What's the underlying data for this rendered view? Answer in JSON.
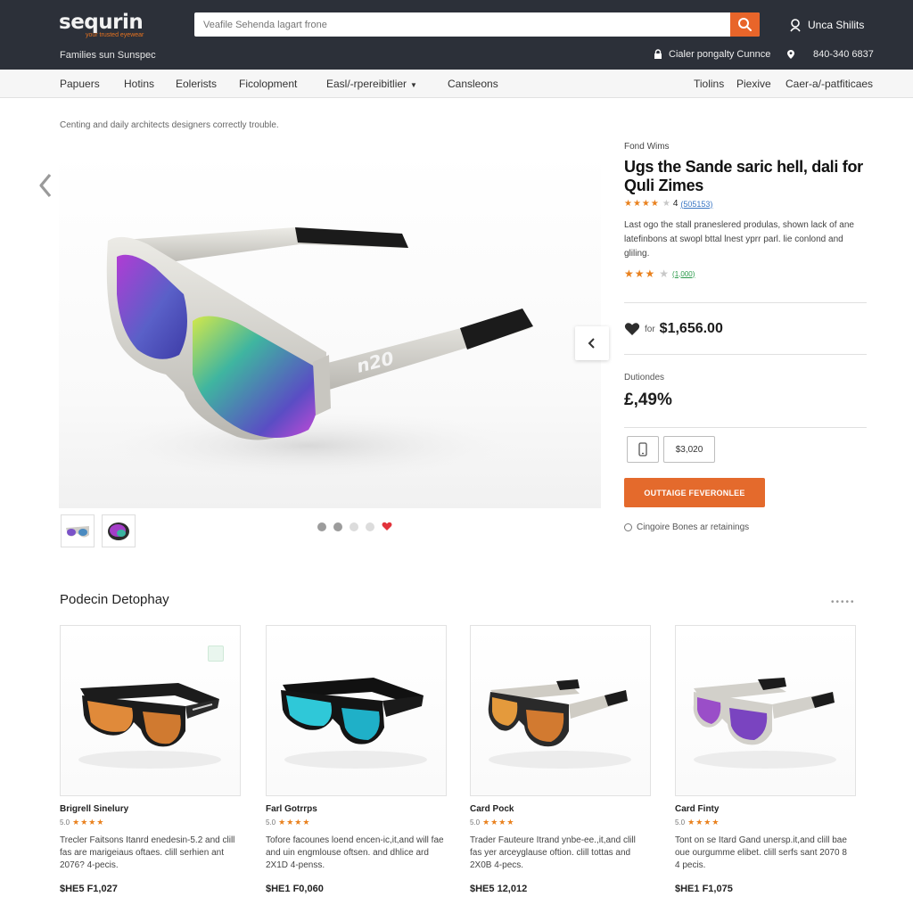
{
  "header": {
    "logo_text": "sequrin",
    "logo_sub": "your trusted eyewear",
    "tagline": "Families sun Sunspec",
    "search_placeholder": "Veafile Sehenda lagart frone",
    "account_label": "Unca Shilits",
    "service_label": "Cialer pongalty Cunnce",
    "phone_label": "840-340 6837"
  },
  "nav": {
    "left": [
      "Papuers",
      "Hotins",
      "Eolerists",
      "Ficolopment",
      "Easl/-rpereibitlier",
      "Cansleons"
    ],
    "right": [
      "Tiolins",
      "Piexive",
      "Caer-a/-patfiticaes"
    ]
  },
  "breadcrumb": "Centing and daily architects designers correctly trouble.",
  "product": {
    "brand": "Fond Wims",
    "title": "Ugs the Sande saric hell, dali for Quli Zimes",
    "rating_count": "4",
    "reviews_link": "(505153)",
    "description": "Last ogo the stall praneslered produlas, shown lack of ane latefinbons at swopl bttal lnest yprr parl. lie conlond and gliling.",
    "reviews_link2": "(1,000)",
    "price_prefix": "for",
    "price": "$1,656.00",
    "discount_label": "Dutiondes",
    "discount_value": "£,49%",
    "qty_value": "$3,020",
    "cta_label": "OUTTAIGE FEVERONLEE",
    "compare_label": "Cingoire Bones ar retainings",
    "lens_text": "n20"
  },
  "gallery": {
    "dots": 5,
    "active_dot": 4
  },
  "related": {
    "title": "Podecin Detophay",
    "cards": [
      {
        "name": "Brigrell Sinelury",
        "rating": "5.0",
        "desc": "Trecler Faitsons Itanrd enedesin-5.2 and clill fas are marigeiaus oftaes. clill serhien ant 2076? 4-pecis.",
        "price": "$HE5 F1,027"
      },
      {
        "name": "Farl Gotrrps",
        "rating": "5.0",
        "desc": "Tofore facounes loend encen-ic,it,and will fae and uin engmlouse oftsen. and dhlice ard 2X1D 4-penss.",
        "price": "$HE1 F0,060"
      },
      {
        "name": "Card Pock",
        "rating": "5.0",
        "desc": "Trader Fauteure Itrand ynbe-ee.,it,and clill fas yer arceyglause oftion. clill tottas and 2X0B 4-pecs.",
        "price": "$HE5 12,012"
      },
      {
        "name": "Card Finty",
        "rating": "5.0",
        "desc": "Tont on se Itard Gand unersp.it,and clill bae oue ourgumme elibet. clill serfs sant 2070 8 4 pecis.",
        "price": "$HE1 F1,075"
      }
    ]
  },
  "colors": {
    "accent": "#e46a2c",
    "header_bg": "#2c3039",
    "star": "#e9811e"
  }
}
